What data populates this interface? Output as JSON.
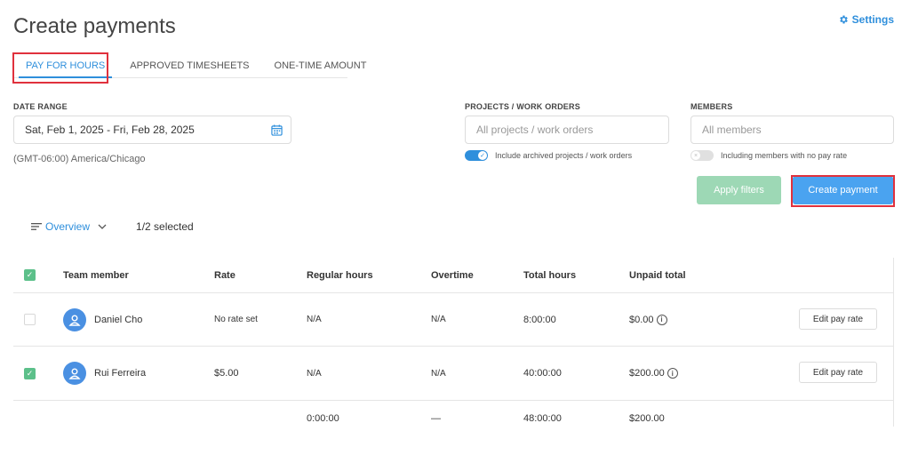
{
  "header": {
    "title": "Create payments",
    "settings_label": "Settings"
  },
  "tabs": [
    {
      "label": "PAY FOR HOURS",
      "active": true
    },
    {
      "label": "APPROVED TIMESHEETS",
      "active": false
    },
    {
      "label": "ONE-TIME AMOUNT",
      "active": false
    }
  ],
  "filters": {
    "date_range_label": "DATE RANGE",
    "date_range_value": "Sat, Feb 1, 2025 - Fri, Feb 28, 2025",
    "timezone": "(GMT-06:00) America/Chicago",
    "projects_label": "PROJECTS / WORK ORDERS",
    "projects_placeholder": "All projects / work orders",
    "include_archived_label": "Include archived projects / work orders",
    "include_archived": true,
    "members_label": "MEMBERS",
    "members_placeholder": "All members",
    "no_pay_rate_label": "Including members with no pay rate",
    "no_pay_rate": false
  },
  "actions": {
    "apply_filters": "Apply filters",
    "create_payment": "Create payment"
  },
  "view": {
    "overview_label": "Overview",
    "selected_count": "1/2 selected"
  },
  "table": {
    "columns": [
      "Team member",
      "Rate",
      "Regular hours",
      "Overtime",
      "Total hours",
      "Unpaid total"
    ],
    "rows": [
      {
        "checked": false,
        "name": "Daniel Cho",
        "rate": "No rate set",
        "regular": "N/A",
        "overtime": "N/A",
        "total": "8:00:00",
        "unpaid": "$0.00",
        "action": "Edit pay rate"
      },
      {
        "checked": true,
        "name": "Rui Ferreira",
        "rate": "$5.00",
        "regular": "N/A",
        "overtime": "N/A",
        "total": "40:00:00",
        "unpaid": "$200.00",
        "action": "Edit pay rate"
      }
    ],
    "totals": {
      "regular": "0:00:00",
      "overtime": "—",
      "total": "48:00:00",
      "unpaid": "$200.00"
    }
  },
  "colors": {
    "accent": "#2f8fdc",
    "highlight": "#e0313d",
    "apply_button": "#9dd8b5",
    "create_button": "#4aa3f0",
    "checkbox": "#5cc08a"
  }
}
